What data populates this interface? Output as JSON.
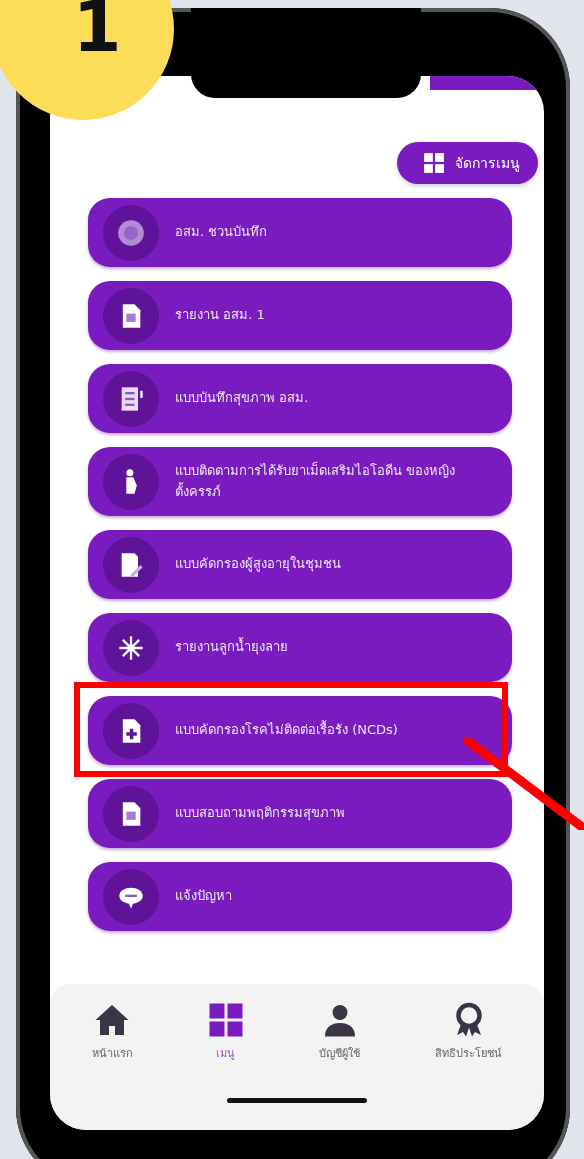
{
  "step_badge": "1",
  "manage_menu_button": {
    "label": "จัดการเมนู"
  },
  "menu_items": [
    {
      "label": "อสม. ชวนบันทึก",
      "highlighted": false
    },
    {
      "label": "รายงาน อสม. 1",
      "highlighted": false
    },
    {
      "label": "แบบบันทึกสุขภาพ อสม.",
      "highlighted": false
    },
    {
      "label": "แบบติดตามการได้รับยาเม็ดเสริมไอโอดีน ของหญิงตั้งครรภ์",
      "highlighted": false
    },
    {
      "label": "แบบคัดกรองผู้สูงอายุในชุมชน",
      "highlighted": false
    },
    {
      "label": "รายงานลูกน้ำยุงลาย",
      "highlighted": false
    },
    {
      "label": "แบบคัดกรองโรคไม่ติดต่อเรื้อรัง (NCDs)",
      "highlighted": true
    },
    {
      "label": "แบบสอบถามพฤติกรรมสุขภาพ",
      "highlighted": false
    },
    {
      "label": "แจ้งปัญหา",
      "highlighted": false
    }
  ],
  "bottom_nav": [
    {
      "label": "หน้าแรก",
      "selected": false
    },
    {
      "label": "เมนู",
      "selected": true
    },
    {
      "label": "บัญชีผู้ใช้",
      "selected": false
    },
    {
      "label": "สิทธิประโยชน์",
      "selected": false
    }
  ]
}
